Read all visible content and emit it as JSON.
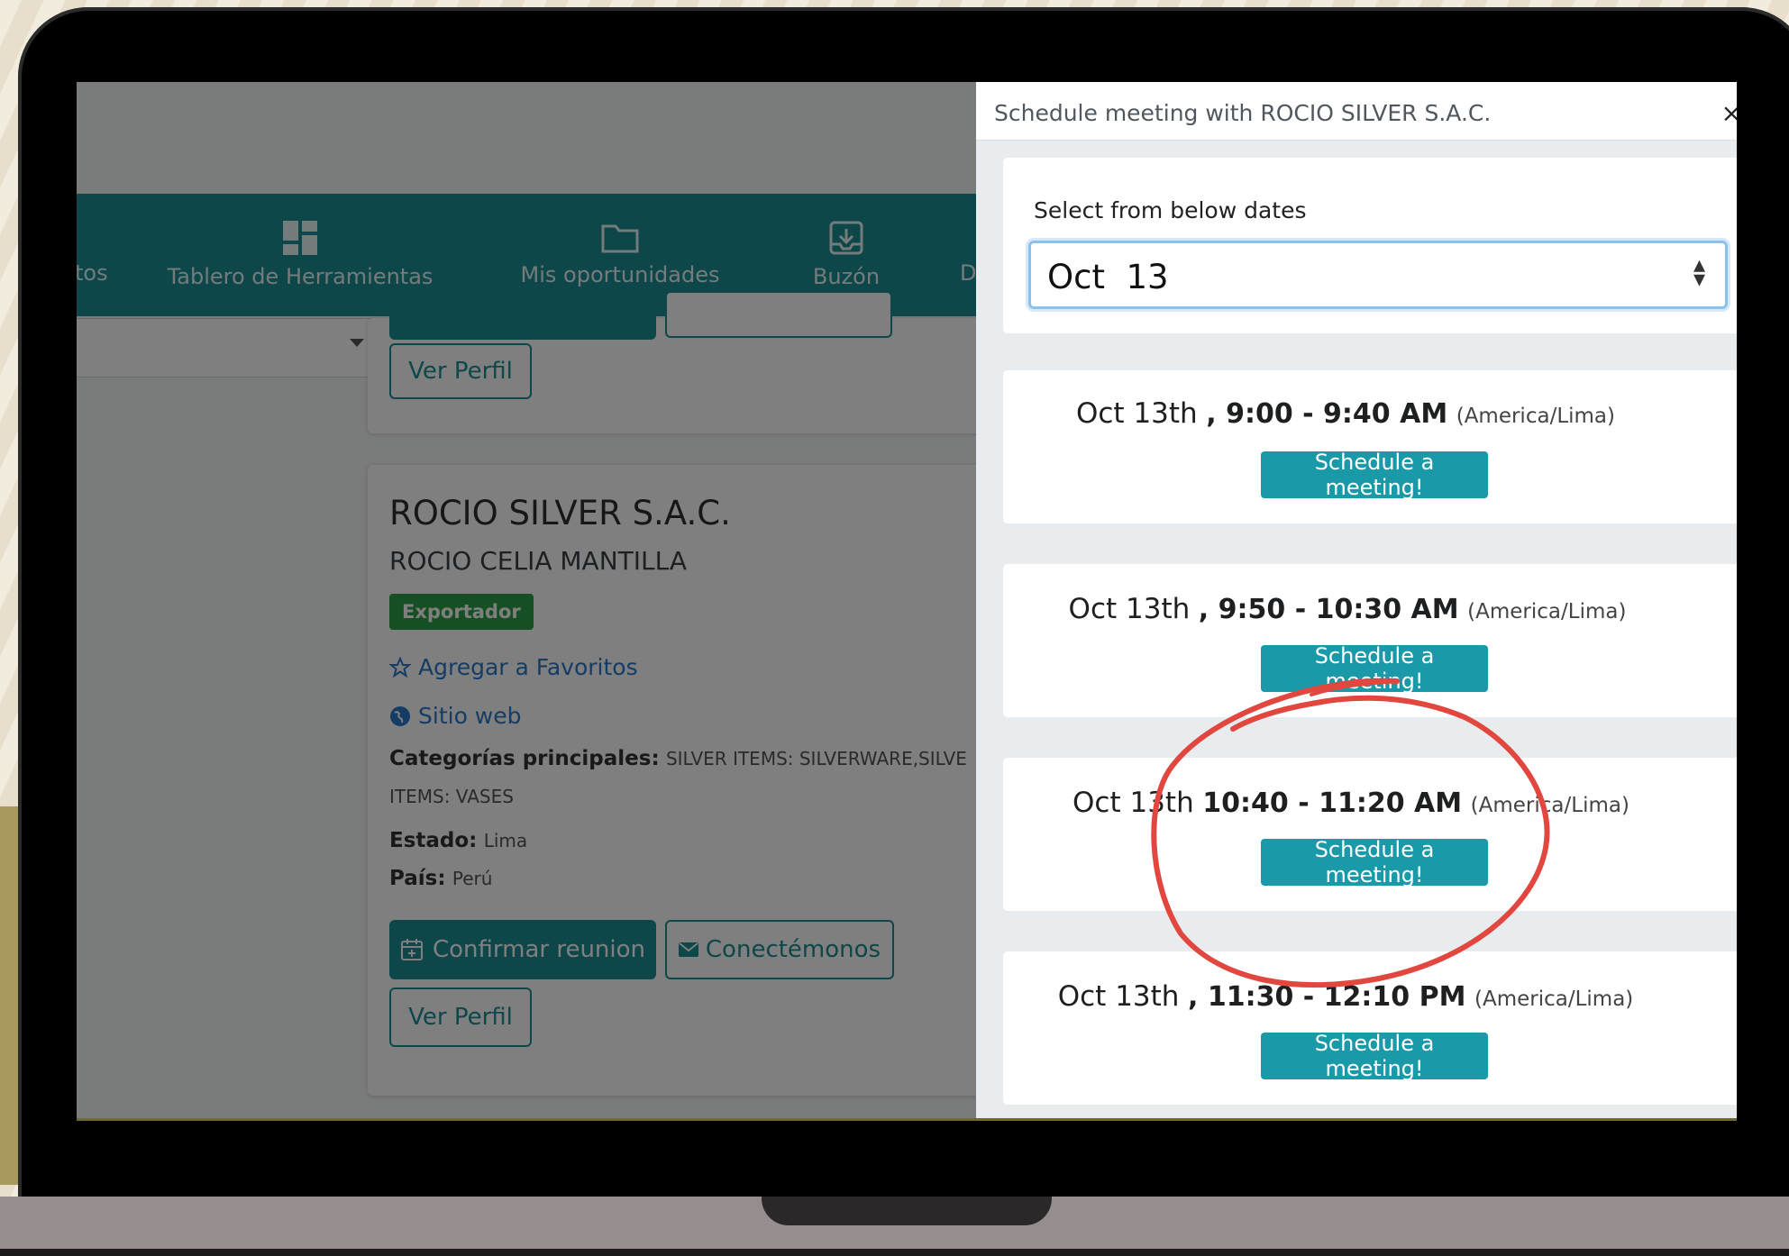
{
  "nav": {
    "items": [
      {
        "label": "tos",
        "icon": "partial-nav-icon"
      },
      {
        "label": "Tablero de Herramientas",
        "icon": "dashboard-icon"
      },
      {
        "label": "Mis oportunidades",
        "icon": "folder-icon"
      },
      {
        "label": "Buzón",
        "icon": "inbox-download-icon"
      },
      {
        "label": "D",
        "icon": "partial-nav-icon"
      }
    ]
  },
  "top_card": {
    "ver_perfil": "Ver Perfil"
  },
  "company_card": {
    "company_name": "ROCIO SILVER S.A.C.",
    "contact_name": "ROCIO CELIA MANTILLA",
    "badge": "Exportador",
    "favorites_link": "Agregar a Favoritos",
    "website_link": "Sitio web",
    "categories_label": "Categorías principales:",
    "categories_value": "SILVER ITEMS: SILVERWARE,SILVE",
    "categories_value_2": "ITEMS: VASES",
    "state_label": "Estado:",
    "state_value": "Lima",
    "country_label": "País:",
    "country_value": "Perú",
    "confirm_button": "Confirmar reunion",
    "connect_button": "Conectémonos",
    "ver_perfil": "Ver Perfil"
  },
  "panel": {
    "title": "Schedule meeting with ROCIO SILVER S.A.C.",
    "close": "×",
    "date_label": "Select from below dates",
    "date_value": "Oct  13",
    "slots": [
      {
        "date": "Oct 13th",
        "time": ", 9:00 - 9:40 AM",
        "tz": "(America/Lima)",
        "button": "Schedule a meeting!"
      },
      {
        "date": "Oct 13th",
        "time": ", 9:50 - 10:30 AM",
        "tz": "(America/Lima)",
        "button": "Schedule a meeting!"
      },
      {
        "date": "Oct 13th",
        "time": " 10:40 - 11:20 AM",
        "tz": "(America/Lima)",
        "button": "Schedule a meeting!"
      },
      {
        "date": "Oct 13th",
        "time": ", 11:30 - 12:10 PM",
        "tz": "(America/Lima)",
        "button": "Schedule a meeting!"
      }
    ]
  },
  "colors": {
    "primary_teal": "#1d8e94",
    "button_teal": "#1a9aa9",
    "badge_green": "#2e9e48",
    "link_blue": "#2a78c8",
    "annotation_red": "#e2473f"
  }
}
